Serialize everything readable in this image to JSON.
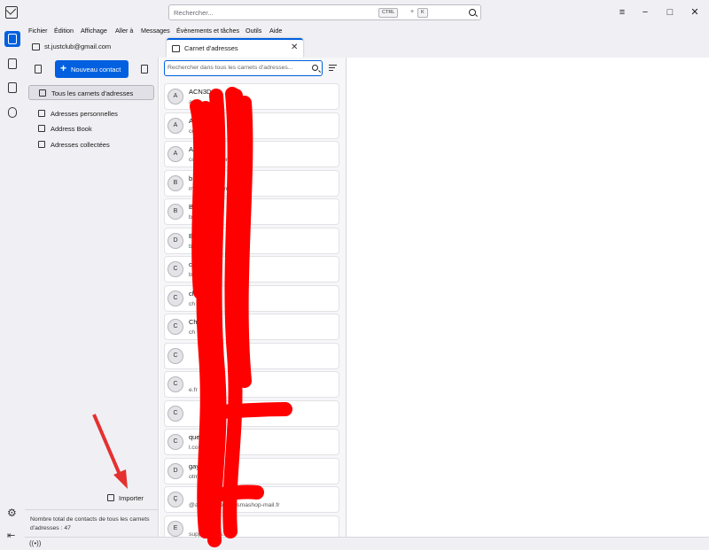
{
  "search": {
    "placeholder": "Rechercher...",
    "kbd_ctrl": "CTRL",
    "kbd_plus": "+",
    "kbd_k": "K"
  },
  "window": {
    "minimize": "−",
    "maximize": "□",
    "close": "✕",
    "menu": "≡"
  },
  "menu": [
    "Fichier",
    "Édition",
    "Affichage",
    "Aller à",
    "Messages",
    "Évènements et tâches",
    "Outils",
    "Aide"
  ],
  "tabs": [
    {
      "label": "st.justclub@gmail.com"
    },
    {
      "label": "Carnet d'adresses",
      "close": "✕"
    }
  ],
  "sidebar": {
    "new_contact": "Nouveau contact",
    "new_contact_plus": "+",
    "all_books": "Tous les carnets d'adresses",
    "books": [
      "Adresses personnelles",
      "Address Book",
      "Adresses collectées"
    ],
    "import": "Importer",
    "total": "Nombre total de contacts de tous les carnets d'adresses : 47"
  },
  "list": {
    "search_placeholder": "Rechercher dans tous les carnets d'adresses...",
    "contacts": [
      {
        "initial": "A",
        "name": "ACN3D",
        "email": "a"
      },
      {
        "initial": "A",
        "name": "A",
        "email": "com"
      },
      {
        "initial": "A",
        "name": "A",
        "email": "communications.com"
      },
      {
        "initial": "B",
        "name": "b",
        "email": "m                   @gmail.com"
      },
      {
        "initial": "B",
        "name": "Be",
        "email": "b                   @orange.fr"
      },
      {
        "initial": "D",
        "name": "Br",
        "email": "b"
      },
      {
        "initial": "C",
        "name": "cat",
        "email": "bou                   il.com"
      },
      {
        "initial": "C",
        "name": "chr",
        "email": "ch                   ail.fr"
      },
      {
        "initial": "C",
        "name": "Ch",
        "email": "ch"
      },
      {
        "initial": "C",
        "name": "",
        "email": ""
      },
      {
        "initial": "C",
        "name": "",
        "email": "e.fr"
      },
      {
        "initial": "C",
        "name": "",
        "email": ""
      },
      {
        "initial": "C",
        "name": "que",
        "email": "l.com"
      },
      {
        "initial": "D",
        "name": "gayot",
        "email": "otmail.fr"
      },
      {
        "initial": "Ç",
        "name": "",
        "email": "@abonnement.prismashop-mail.fr"
      },
      {
        "initial": "E",
        "name": "",
        "email": "supp           easeus.com"
      }
    ]
  },
  "colors": {
    "accent": "#0060df",
    "scribble": "#ff0000"
  },
  "icons": {
    "app": "mail-icon",
    "settings": "gear-icon",
    "collapse": "collapse-icon",
    "status": "wifi-status-icon"
  }
}
